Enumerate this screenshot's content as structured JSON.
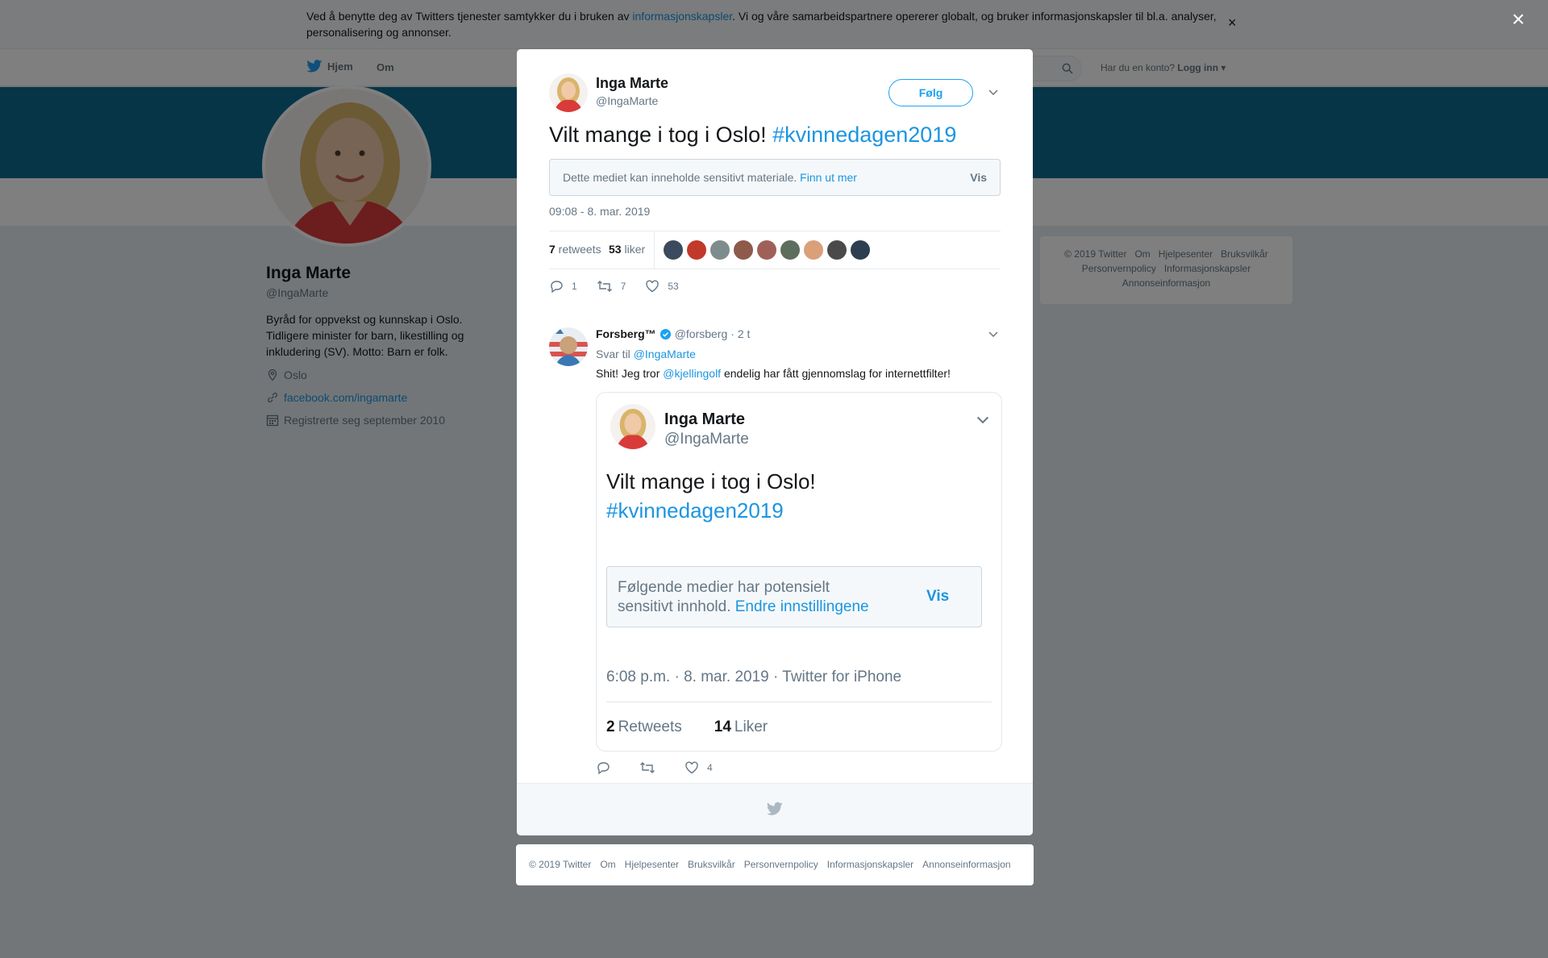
{
  "cookie": {
    "text_before": "Ved å benytte deg av Twitters tjenester samtykker du i bruken av ",
    "link": "informasjonskapsler",
    "text_after": ". Vi og våre samarbeidspartnere opererer globalt, og bruker informasjonskapsler til bl.a. analyser, personalisering og annonser.",
    "close": "×"
  },
  "nav": {
    "home": "Hjem",
    "about": "Om",
    "account_q": "Har du en konto?",
    "login": "Logg inn"
  },
  "profile": {
    "name": "Inga Marte",
    "handle": "@IngaMarte",
    "bio": "Byråd for oppvekst og kunnskap i Oslo. Tidligere minister for barn, likestilling og inkludering (SV). Motto: Barn er folk.",
    "location": "Oslo",
    "website": "facebook.com/ingamarte",
    "joined": "Registrerte seg september 2010"
  },
  "right_footer": [
    "© 2019 Twitter",
    "Om",
    "Hjelpesenter",
    "Bruksvilkår",
    "Personvernpolicy",
    "Informasjonskapsler",
    "Annonseinformasjon"
  ],
  "overlay_close": "×",
  "tweet": {
    "author_name": "Inga Marte",
    "author_handle": "@IngaMarte",
    "follow": "Følg",
    "text": "Vilt mange i tog i Oslo! ",
    "hashtag": "#kvinnedagen2019",
    "sensitive_text": "Dette mediet kan inneholde sensitivt materiale. ",
    "sensitive_link": "Finn ut mer",
    "sensitive_show": "Vis",
    "date": "09:08 - 8. mar. 2019",
    "retweets": "7",
    "retweets_label": " retweets",
    "likes": "53",
    "likes_label": " liker",
    "likers_colors": [
      "#3b4a5c",
      "#c0392b",
      "#7f8c8d",
      "#8e5a4a",
      "#a0605a",
      "#5d6d5e",
      "#d9a07a",
      "#4a4a4a",
      "#2c3e50"
    ],
    "actions": {
      "reply": "1",
      "retweet": "7",
      "like": "53"
    }
  },
  "reply": {
    "name": "Forsberg™",
    "handle": "@forsberg",
    "time": "· 2 t",
    "reply_to_label": "Svar til ",
    "reply_to": "@IngaMarte",
    "text_before": "Shit! Jeg tror ",
    "mention": "@kjellingolf",
    "text_after": " endelig har fått gjennomslag for internettfilter!",
    "actions": {
      "like": "4"
    }
  },
  "embed": {
    "name": "Inga Marte",
    "handle": "@IngaMarte",
    "text": "Vilt mange i tog i Oslo!",
    "hashtag": "#kvinnedagen2019",
    "sensitive_text": "Følgende medier har potensielt sensitivt innhold. ",
    "sensitive_link": "Endre innstillingene",
    "sensitive_show": "Vis",
    "date": "6:08 p.m. · 8. mar. 2019 · Twitter for iPhone",
    "retweets": "2",
    "retweets_label": "Retweets",
    "likes": "14",
    "likes_label": "Liker"
  },
  "footer": [
    "© 2019 Twitter",
    "Om",
    "Hjelpesenter",
    "Bruksvilkår",
    "Personvernpolicy",
    "Informasjonskapsler",
    "Annonseinformasjon"
  ],
  "colors": {
    "accent": "#1da1f2",
    "link": "#1b95e0",
    "banner": "#0c6a8f"
  }
}
